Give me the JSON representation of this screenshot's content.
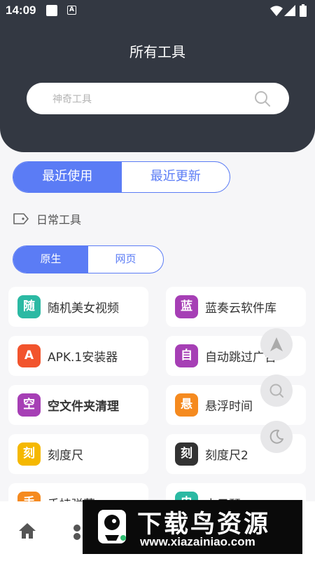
{
  "status_bar": {
    "time": "14:09",
    "notification_icon": "A"
  },
  "header": {
    "title": "所有工具"
  },
  "search": {
    "placeholder": "神奇工具"
  },
  "tabs": [
    {
      "label": "最近使用",
      "active": true
    },
    {
      "label": "最近更新",
      "active": false
    }
  ],
  "section": {
    "label": "日常工具"
  },
  "subtabs": [
    {
      "label": "原生",
      "active": true
    },
    {
      "label": "网页",
      "active": false
    }
  ],
  "tools": [
    {
      "icon": "随",
      "label": "随机美女视频",
      "color": "#2bb9a3"
    },
    {
      "icon": "蓝",
      "label": "蓝奏云软件库",
      "color": "#a63fb5"
    },
    {
      "icon": "A",
      "label": "APK.1安装器",
      "color": "#f2542d"
    },
    {
      "icon": "自",
      "label": "自动跳过广告",
      "color": "#a63fb5"
    },
    {
      "icon": "空",
      "label": "空文件夹清理",
      "color": "#a63fb5"
    },
    {
      "icon": "悬",
      "label": "悬浮时间",
      "color": "#f58a1f"
    },
    {
      "icon": "刻",
      "label": "刻度尺",
      "color": "#f5b800"
    },
    {
      "icon": "刻",
      "label": "刻度尺2",
      "color": "#333333"
    },
    {
      "icon": "手",
      "label": "手持弹幕",
      "color": "#f58a1f"
    },
    {
      "icon": "电",
      "label": "电子琴",
      "color": "#2bb9a3"
    }
  ],
  "fabs": [
    {
      "icon": "navigation-arrow-icon"
    },
    {
      "icon": "search-icon"
    },
    {
      "icon": "night-mode-icon"
    }
  ],
  "bottom_nav": [
    {
      "icon": "home-icon"
    },
    {
      "icon": "grid-icon"
    }
  ],
  "watermark": {
    "title": "下载鸟资源",
    "url": "www.xiazainiao.com"
  },
  "colors": {
    "header_bg": "#333842",
    "accent": "#5b7cf5",
    "page_bg": "#f6f6f8"
  }
}
